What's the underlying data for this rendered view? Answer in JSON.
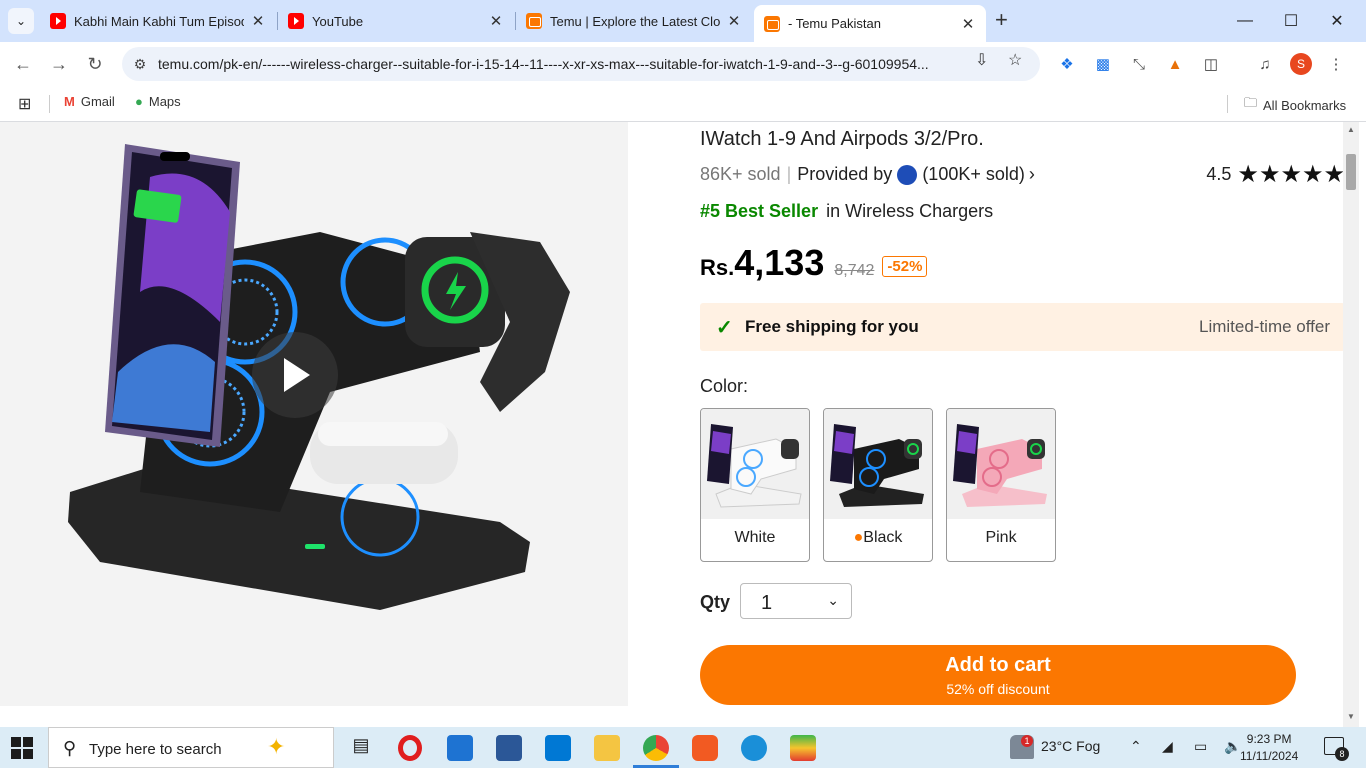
{
  "browser": {
    "tabs": [
      {
        "title": "Kabhi Main Kabhi Tum Episode",
        "icon": "youtube-icon"
      },
      {
        "title": "YouTube",
        "icon": "youtube-icon"
      },
      {
        "title": "Temu | Explore the Latest Clothi",
        "icon": "temu-icon"
      },
      {
        "title": "- Temu Pakistan",
        "icon": "temu-icon",
        "active": true
      }
    ],
    "url": "temu.com/pk-en/------wireless-charger--suitable-for-i-15-14--11----x-xr-xs-max---suitable-for-iwatch-1-9-and--3--g-60109954...",
    "profile_initial": "S",
    "bookmarks": {
      "gmail": "Gmail",
      "maps": "Maps",
      "all": "All Bookmarks"
    }
  },
  "product": {
    "title_tail": "IWatch 1-9 And Airpods 3/2/Pro.",
    "sold": "86K+ sold",
    "provided_by": "Provided by",
    "store_sold": "(100K+ sold)",
    "rating": "4.5",
    "best_rank": "#5 Best Seller",
    "best_category": "in Wireless Chargers",
    "currency": "Rs.",
    "price": "4,133",
    "old_price": "8,742",
    "discount": "-52%",
    "shipping": "Free shipping for you",
    "offer": "Limited-time offer",
    "color_label": "Color:",
    "colors": [
      "White",
      "Black",
      "Pink"
    ],
    "qty_label": "Qty",
    "qty_value": "1",
    "cart_label": "Add to cart",
    "cart_sub": "52% off discount"
  },
  "taskbar": {
    "search_placeholder": "Type here to search",
    "weather": "23°C  Fog",
    "weather_badge": "1",
    "time": "9:23 PM",
    "date": "11/11/2024",
    "notif_count": "8"
  },
  "colors": {
    "temu_orange": "#fb7701",
    "best_green": "#0a8800",
    "tab_bg": "#d3e3fd"
  }
}
